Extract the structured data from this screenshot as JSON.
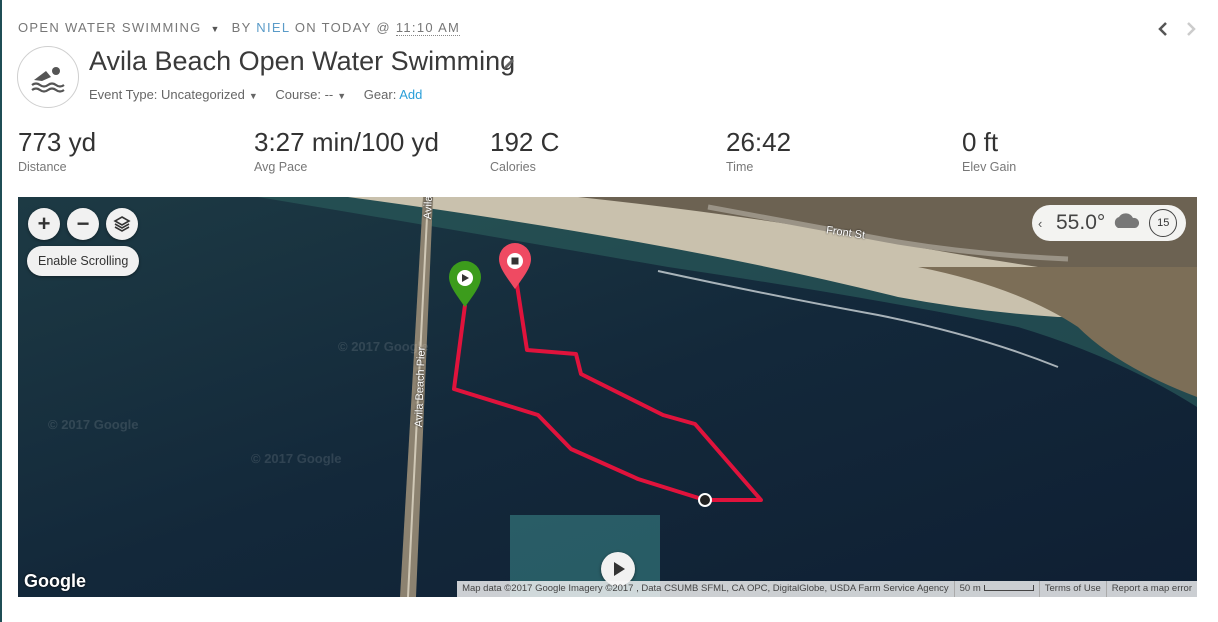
{
  "header": {
    "activity_type": "OPEN WATER SWIMMING",
    "by_label": "BY",
    "user": "NIEL",
    "on_label": "ON TODAY @",
    "time": "11:10 AM"
  },
  "activity": {
    "icon": "swimmer-icon",
    "title": "Avila Beach Open Water Swimming",
    "event_type_label": "Event Type:",
    "event_type_value": "Uncategorized",
    "course_label": "Course:",
    "course_value": "--",
    "gear_label": "Gear:",
    "gear_add": "Add"
  },
  "stats": [
    {
      "value": "773 yd",
      "label": "Distance"
    },
    {
      "value": "3:27 min/100 yd",
      "label": "Avg Pace"
    },
    {
      "value": "192 C",
      "label": "Calories"
    },
    {
      "value": "26:42",
      "label": "Time"
    },
    {
      "value": "0 ft",
      "label": "Elev Gain"
    }
  ],
  "map": {
    "zoom_in": "+",
    "zoom_out": "−",
    "enable_scrolling": "Enable Scrolling",
    "weather_temp": "55.0°",
    "wind_speed": "15",
    "street_front": "Front St",
    "street_avila": "Avila",
    "pier_label": "Avila Beach Pier",
    "watermark": "© 2017 Google",
    "google_logo": "Google",
    "attribution": "Map data ©2017 Google Imagery ©2017 , Data CSUMB SFML, CA OPC, DigitalGlobe, USDA Farm Service Agency",
    "scale_label": "50 m",
    "terms": "Terms of Use",
    "report": "Report a map error",
    "route_color": "#e0133c",
    "start_color": "#3c9c1c",
    "end_color": "#ef4a62"
  }
}
